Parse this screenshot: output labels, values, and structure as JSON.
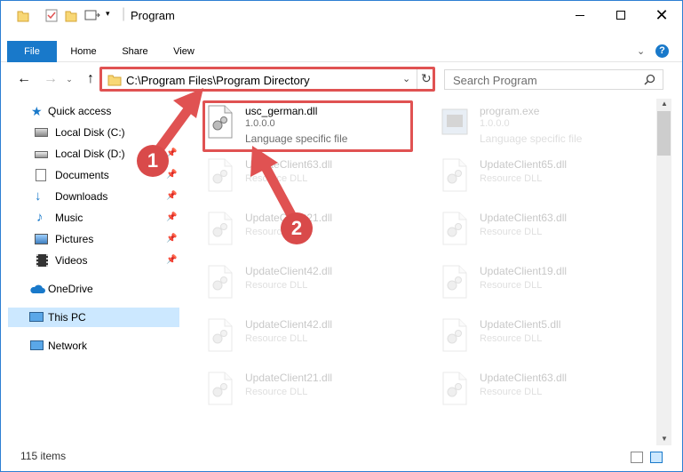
{
  "window": {
    "title": "Program"
  },
  "ribbon": {
    "tabs": [
      {
        "label": "File"
      },
      {
        "label": "Home"
      },
      {
        "label": "Share"
      },
      {
        "label": "View"
      }
    ]
  },
  "address": {
    "path": "C:\\Program Files\\Program Directory"
  },
  "search": {
    "placeholder": "Search Program"
  },
  "nav": {
    "quick_access": "Quick access",
    "items": [
      {
        "label": "Local Disk (C:)"
      },
      {
        "label": "Local Disk (D:)"
      },
      {
        "label": "Documents"
      },
      {
        "label": "Downloads"
      },
      {
        "label": "Music"
      },
      {
        "label": "Pictures"
      },
      {
        "label": "Videos"
      }
    ],
    "onedrive": "OneDrive",
    "this_pc": "This PC",
    "network": "Network"
  },
  "files": [
    {
      "name": "usc_german.dll",
      "sub": "1.0.0.0",
      "desc": "Language specific file"
    },
    {
      "name": "program.exe",
      "sub": "1.0.0.0",
      "desc": "Language specific file"
    },
    {
      "name": "UpdateClient63.dll",
      "desc": "Resource DLL"
    },
    {
      "name": "UpdateClient65.dll",
      "desc": "Resource DLL"
    },
    {
      "name": "UpdateClient21.dll",
      "desc": "Resource DLL"
    },
    {
      "name": "UpdateClient63.dll",
      "desc": "Resource DLL"
    },
    {
      "name": "UpdateClient42.dll",
      "desc": "Resource DLL"
    },
    {
      "name": "UpdateClient19.dll",
      "desc": "Resource DLL"
    },
    {
      "name": "UpdateClient42.dll",
      "desc": "Resource DLL"
    },
    {
      "name": "UpdateClient5.dll",
      "desc": "Resource DLL"
    },
    {
      "name": "UpdateClient21.dll",
      "desc": "Resource DLL"
    },
    {
      "name": "UpdateClient63.dll",
      "desc": "Resource DLL"
    }
  ],
  "status": {
    "count": "115 items"
  },
  "annotations": {
    "step1": "1",
    "step2": "2"
  },
  "colors": {
    "accent": "#1979ca",
    "highlight": "#e05252",
    "selected": "#cce8ff"
  }
}
